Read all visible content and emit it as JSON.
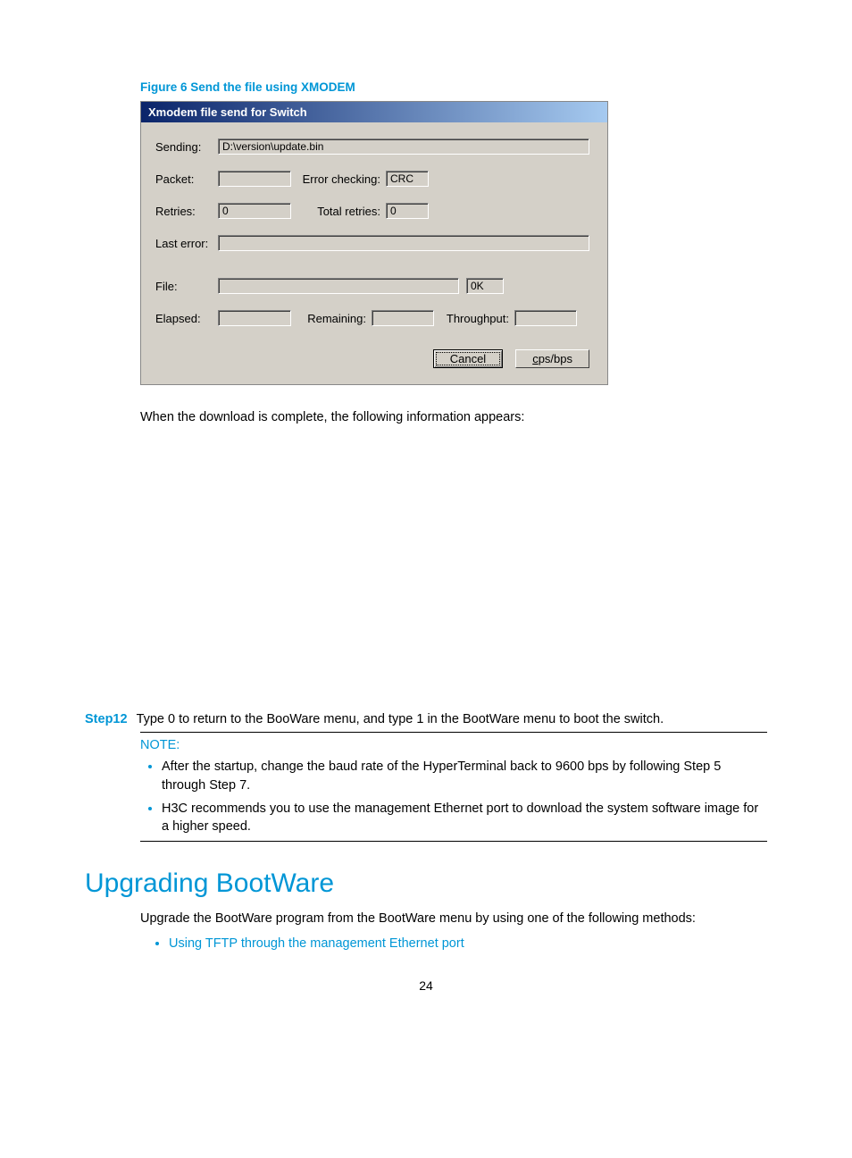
{
  "figure": {
    "caption": "Figure 6 Send the file using XMODEM"
  },
  "dialog": {
    "title": "Xmodem file send for Switch",
    "labels": {
      "sending": "Sending:",
      "packet": "Packet:",
      "error_checking": "Error checking:",
      "retries": "Retries:",
      "total_retries": "Total retries:",
      "last_error": "Last error:",
      "file": "File:",
      "elapsed": "Elapsed:",
      "remaining": "Remaining:",
      "throughput": "Throughput:"
    },
    "values": {
      "sending": "D:\\version\\update.bin",
      "packet": "",
      "error_checking": "CRC",
      "retries": "0",
      "total_retries": "0",
      "last_error": "",
      "file_progress": "",
      "file_size": "0K",
      "elapsed": "",
      "remaining": "",
      "throughput": ""
    },
    "buttons": {
      "cancel": "Cancel",
      "cpsbps": "cps/bps"
    }
  },
  "para_after_download": "When the download is complete, the following information appears:",
  "step12": {
    "label": "Step12",
    "text": "Type 0 to return to the BooWare menu, and type 1 in the BootWare menu to boot the switch."
  },
  "note": {
    "label": "NOTE:",
    "items": [
      "After the startup, change the baud rate of the HyperTerminal back to 9600 bps by following Step 5 through Step 7.",
      "H3C recommends you to use the management Ethernet port to download the system software image for a higher speed."
    ]
  },
  "section": {
    "heading": "Upgrading BootWare",
    "para": "Upgrade the BootWare program from the BootWare menu by using one of the following methods:",
    "bullets": [
      "Using TFTP through the management Ethernet port"
    ]
  },
  "page_number": "24"
}
